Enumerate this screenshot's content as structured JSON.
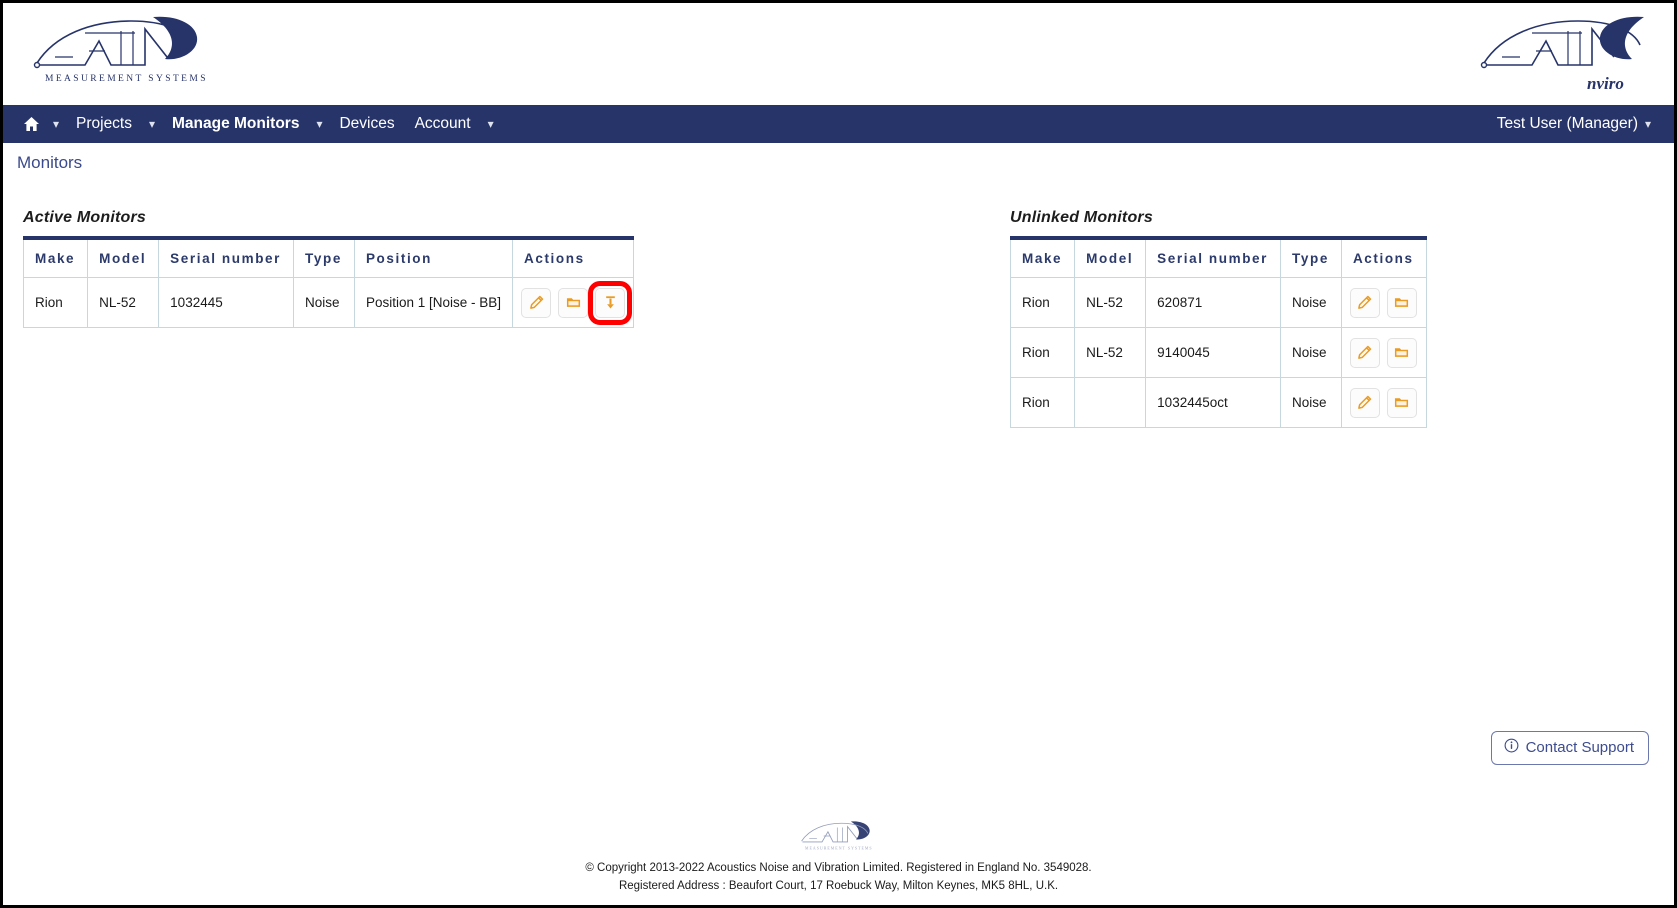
{
  "window": {
    "page_title": "Monitors"
  },
  "header": {
    "left_logo": {
      "name": "anv-logo",
      "wordmark": "ANV",
      "tagline": "MEASUREMENT SYSTEMS"
    },
    "right_logo": {
      "name": "anv-enviro-logo",
      "wordmark": "ANV",
      "subtext": "nviro"
    }
  },
  "nav": {
    "home_icon": "home-icon",
    "items": [
      {
        "label": "Projects",
        "has_caret": true,
        "active": false
      },
      {
        "label": "Manage Monitors",
        "has_caret": true,
        "active": true
      },
      {
        "label": "Devices",
        "has_caret": false,
        "active": false
      },
      {
        "label": "Account",
        "has_caret": true,
        "active": false
      }
    ],
    "user": {
      "label": "Test User (Manager)",
      "caret": "chevron-down-icon"
    },
    "bar_color": "#27346a"
  },
  "tables": {
    "active": {
      "title": "Active Monitors",
      "columns": [
        "Make",
        "Model",
        "Serial number",
        "Type",
        "Position",
        "Actions"
      ],
      "rows": [
        {
          "make": "Rion",
          "model": "NL-52",
          "serial": "1032445",
          "type": "Noise",
          "position": "Position 1 [Noise - BB]",
          "actions": [
            {
              "icon": "pencil-edit-icon",
              "highlighted": false
            },
            {
              "icon": "folder-icon",
              "highlighted": false
            },
            {
              "icon": "unlink-download-icon",
              "highlighted": true
            }
          ]
        }
      ]
    },
    "unlinked": {
      "title": "Unlinked Monitors",
      "columns": [
        "Make",
        "Model",
        "Serial number",
        "Type",
        "Actions"
      ],
      "rows": [
        {
          "make": "Rion",
          "model": "NL-52",
          "serial": "620871",
          "type": "Noise",
          "actions": [
            {
              "icon": "pencil-edit-icon",
              "highlighted": false
            },
            {
              "icon": "folder-icon",
              "highlighted": false
            }
          ]
        },
        {
          "make": "Rion",
          "model": "NL-52",
          "serial": "9140045",
          "type": "Noise",
          "actions": [
            {
              "icon": "pencil-edit-icon",
              "highlighted": false
            },
            {
              "icon": "folder-icon",
              "highlighted": false
            }
          ]
        },
        {
          "make": "Rion",
          "model": "",
          "serial": "1032445oct",
          "type": "Noise",
          "actions": [
            {
              "icon": "pencil-edit-icon",
              "highlighted": false
            },
            {
              "icon": "folder-icon",
              "highlighted": false
            }
          ]
        }
      ]
    }
  },
  "support": {
    "label": "Contact Support",
    "icon": "info-circle-icon"
  },
  "footer": {
    "logo": "anv-logo-small",
    "copyright": "© Copyright 2013-2022 Acoustics Noise and Vibration Limited. Registered in England No. 3549028.",
    "address": "Registered Address : Beaufort Court, 17 Roebuck Way, Milton Keynes, MK5 8HL, U.K."
  },
  "colors": {
    "nav_bg": "#27346a",
    "table_header_text": "#2b3a6b",
    "table_top_rule": "#27346a",
    "icon_orange": "#eb9b22",
    "highlight_red": "#fe0000",
    "link_blue": "#3b4a8c"
  }
}
